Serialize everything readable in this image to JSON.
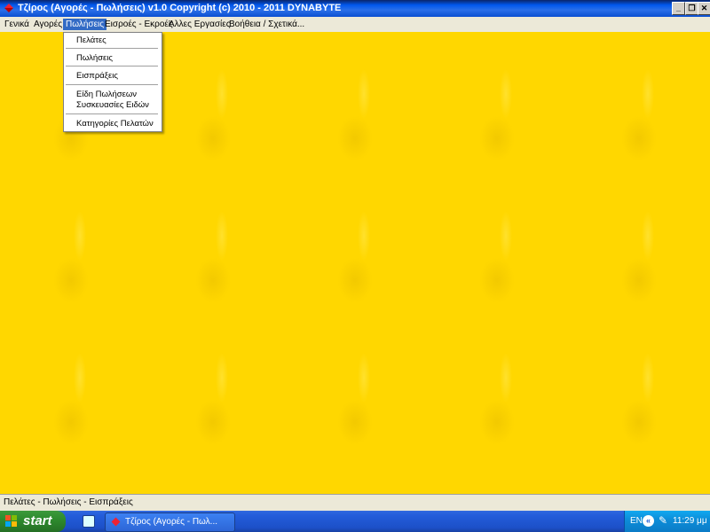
{
  "window": {
    "title": "Τζίρος (Αγορές - Πωλήσεις)  v1.0    Copyright (c) 2010 - 2011  DYNABYTE",
    "minimize_glyph": "_",
    "restore_glyph": "❐",
    "close_glyph": "✕"
  },
  "menubar": {
    "items": [
      "Γενικά",
      "Αγορές",
      "Πωλήσεις",
      "Εισροές - Εκροές",
      "Άλλες Εργασίες",
      "Βοήθεια / Σχετικά..."
    ],
    "active": "Πωλήσεις"
  },
  "dropdown": {
    "items": [
      "Πελάτες",
      "Πωλήσεις",
      "Εισπράξεις",
      "Είδη Πωλήσεων",
      "Συσκευασίες Ειδών",
      "Κατηγορίες Πελατών"
    ]
  },
  "statusbar": {
    "text": "Πελάτες - Πωλήσεις - Εισπράξεις"
  },
  "taskbar": {
    "start_label": "start",
    "task_label": "Τζίρος (Αγορές - Πωλ...",
    "language": "EN",
    "clock": "11:29 μμ",
    "back_glyph": "«",
    "pen_glyph": "✎"
  },
  "colors": {
    "desktop": "#ffd700",
    "accent": "#316ac5",
    "titlebar": "#0058ee",
    "taskbar": "#245edb"
  }
}
